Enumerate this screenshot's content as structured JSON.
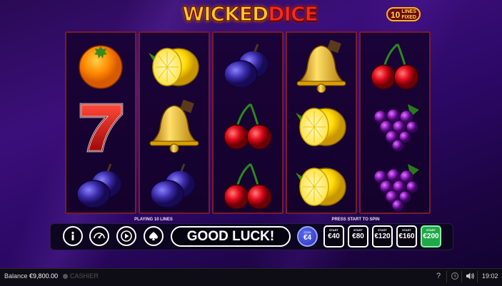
{
  "game": {
    "title_part1": "WICKED",
    "title_part2": "DICE",
    "lines_badge_number": "10",
    "lines_badge_text1": "LINES",
    "lines_badge_text2": "FIXED"
  },
  "reels": [
    [
      "orange",
      "seven",
      "plum"
    ],
    [
      "lemon",
      "bell",
      "plum"
    ],
    [
      "plum",
      "cherry",
      "cherry"
    ],
    [
      "bell",
      "lemon",
      "lemon"
    ],
    [
      "cherry",
      "grapes",
      "grapes"
    ]
  ],
  "controls": {
    "playing_lines": "PLAYING 10 LINES",
    "press_start": "PRESS START TO SPIN",
    "message": "GOOD LUCK!",
    "coin_label": "COIN",
    "coin_value": "€4",
    "bets": [
      {
        "label": "START",
        "value": "€40",
        "active": false
      },
      {
        "label": "START",
        "value": "€80",
        "active": false
      },
      {
        "label": "START",
        "value": "€120",
        "active": false
      },
      {
        "label": "START",
        "value": "€160",
        "active": false
      },
      {
        "label": "START",
        "value": "€200",
        "active": true
      }
    ],
    "icons": [
      "info-icon",
      "speedometer-icon",
      "autoplay-icon",
      "spade-icon"
    ]
  },
  "footer": {
    "balance_label": "Balance",
    "balance_value": "€9,800.00",
    "cashier": "CASHIER",
    "time": "19:02"
  },
  "colors": {
    "reel_border": "#7a1a2a",
    "active_bet": "#1fa847",
    "coin": "#3a46d0"
  }
}
